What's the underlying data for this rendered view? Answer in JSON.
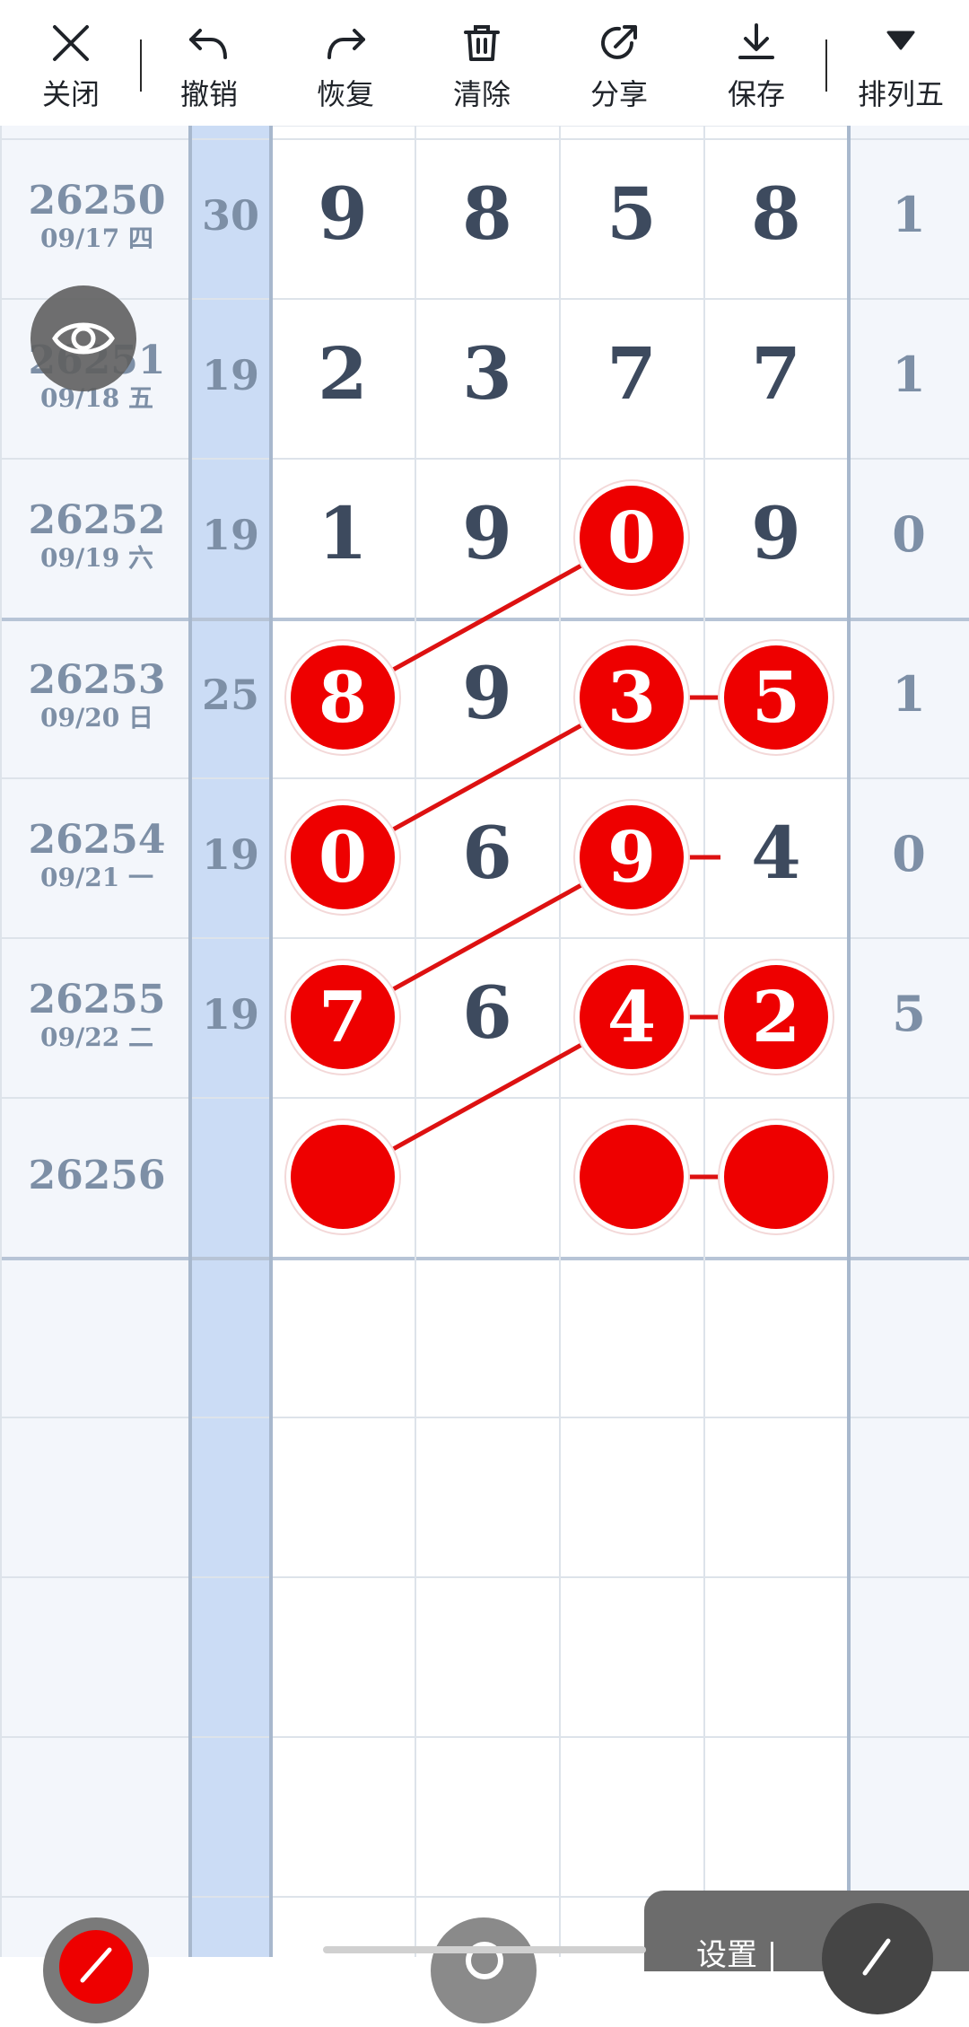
{
  "toolbar": {
    "close": "关闭",
    "undo": "撤销",
    "redo": "恢复",
    "clear": "清除",
    "share": "分享",
    "save": "保存",
    "lottery": "排列五"
  },
  "rows": [
    {
      "issue": "26250",
      "date": "09/17 四",
      "sum": "30",
      "digits": [
        "9",
        "8",
        "5",
        "8"
      ],
      "last": "1"
    },
    {
      "issue": "26251",
      "date": "09/18 五",
      "sum": "19",
      "digits": [
        "2",
        "3",
        "7",
        "7"
      ],
      "last": "1"
    },
    {
      "issue": "26252",
      "date": "09/19 六",
      "sum": "19",
      "digits": [
        "1",
        "9",
        "0",
        "9"
      ],
      "last": "0"
    },
    {
      "issue": "26253",
      "date": "09/20 日",
      "sum": "25",
      "digits": [
        "8",
        "9",
        "3",
        "5"
      ],
      "last": "1"
    },
    {
      "issue": "26254",
      "date": "09/21 一",
      "sum": "19",
      "digits": [
        "0",
        "6",
        "9",
        "4"
      ],
      "last": "0"
    },
    {
      "issue": "26255",
      "date": "09/22 二",
      "sum": "19",
      "digits": [
        "7",
        "6",
        "4",
        "2"
      ],
      "last": "5"
    },
    {
      "issue": "26256",
      "date": "",
      "sum": "",
      "digits": [
        "",
        "",
        "",
        ""
      ],
      "last": ""
    }
  ],
  "marked": [
    {
      "row": 2,
      "col": 2
    },
    {
      "row": 3,
      "col": 0
    },
    {
      "row": 3,
      "col": 2
    },
    {
      "row": 3,
      "col": 3
    },
    {
      "row": 4,
      "col": 0
    },
    {
      "row": 4,
      "col": 2
    },
    {
      "row": 5,
      "col": 0
    },
    {
      "row": 5,
      "col": 2
    },
    {
      "row": 5,
      "col": 3
    },
    {
      "row": 6,
      "col": 0
    },
    {
      "row": 6,
      "col": 2
    },
    {
      "row": 6,
      "col": 3
    }
  ],
  "links": [
    [
      {
        "row": 2,
        "col": 2
      },
      {
        "row": 3,
        "col": 0
      }
    ],
    [
      {
        "row": 3,
        "col": 2
      },
      {
        "row": 3,
        "col": 3
      }
    ],
    [
      {
        "row": 3,
        "col": 2
      },
      {
        "row": 4,
        "col": 0
      }
    ],
    [
      {
        "row": 4,
        "col": 2
      },
      {
        "row": 4,
        "col": 3
      }
    ],
    [
      {
        "row": 4,
        "col": 2
      },
      {
        "row": 5,
        "col": 0
      }
    ],
    [
      {
        "row": 5,
        "col": 2
      },
      {
        "row": 5,
        "col": 3
      }
    ],
    [
      {
        "row": 5,
        "col": 2
      },
      {
        "row": 6,
        "col": 0
      }
    ],
    [
      {
        "row": 6,
        "col": 2
      },
      {
        "row": 6,
        "col": 3
      }
    ]
  ],
  "widgets": {
    "settings_label": "设置 |",
    "eye_icon": "eye-icon",
    "edit_icon": "pencil-icon",
    "brush_icon": "brush-icon",
    "search_icon": "search-icon"
  },
  "colors": {
    "ball": "#ee0000",
    "sum_column": "#cbdcf5",
    "side_column": "#f3f6fb",
    "digit_text": "#3d4a5e",
    "muted_text": "#7d8fa6"
  }
}
